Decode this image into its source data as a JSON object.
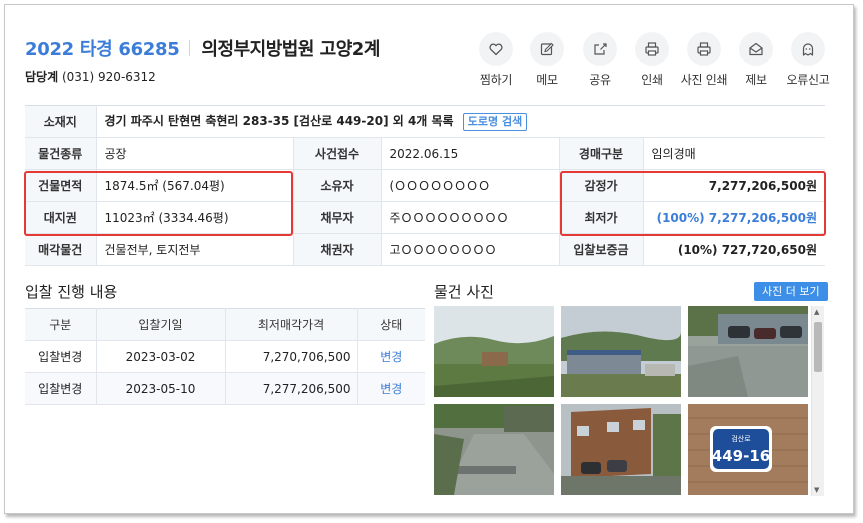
{
  "header": {
    "case_number": "2022 타경 66285",
    "court": "의정부지방법원 고양2계",
    "contact_label": "담당계",
    "contact_phone": "(031) 920-6312"
  },
  "actions": [
    {
      "label": "찜하기",
      "icon": "heart-icon"
    },
    {
      "label": "메모",
      "icon": "pencil-icon"
    },
    {
      "label": "공유",
      "icon": "share-icon"
    },
    {
      "label": "인쇄",
      "icon": "printer-icon"
    },
    {
      "label": "사진 인쇄",
      "icon": "printer-icon"
    },
    {
      "label": "제보",
      "icon": "envelope-icon"
    },
    {
      "label": "오류신고",
      "icon": "ghost-icon"
    }
  ],
  "info": {
    "location_label": "소재지",
    "location_value": "경기 파주시 탄현면 축현리 283-35 [검산로 449-20] 외 4개 목록",
    "road_search": "도로명 검색",
    "type_label": "물건종류",
    "type_value": "공장",
    "received_label": "사건접수",
    "received_value": "2022.06.15",
    "auction_type_label": "경매구분",
    "auction_type_value": "임의경매",
    "building_area_label": "건물면적",
    "building_area_value": "1874.5㎡ (567.04평)",
    "owner_label": "소유자",
    "owner_value": "(ＯＯＯＯＯＯＯＯ",
    "appraisal_label": "감정가",
    "appraisal_value": "7,277,206,500원",
    "land_right_label": "대지권",
    "land_right_value": "11023㎡ (3334.46평)",
    "debtor_label": "채무자",
    "debtor_value": "주ＯＯＯＯＯＯＯＯＯ",
    "min_price_label": "최저가",
    "min_price_value": "(100%) 7,277,206,500원",
    "sale_label": "매각물건",
    "sale_value": "건물전부, 토지전부",
    "creditor_label": "채권자",
    "creditor_value": "고ＯＯＯＯＯＯＯＯ",
    "deposit_label": "입찰보증금",
    "deposit_value": "(10%) 727,720,650원"
  },
  "bid_section": {
    "title": "입찰 진행 내용",
    "headers": [
      "구분",
      "입찰기일",
      "최저매각가격",
      "상태"
    ],
    "rows": [
      {
        "type": "입찰변경",
        "date": "2023-03-02",
        "price": "7,270,706,500",
        "status": "변경"
      },
      {
        "type": "입찰변경",
        "date": "2023-05-10",
        "price": "7,277,206,500",
        "status": "변경"
      }
    ]
  },
  "photo_section": {
    "title": "물건 사진",
    "more_button": "사진 더 보기",
    "sign_line1": "검산로",
    "sign_line2": "449-16",
    "colors": {
      "accent": "#3b7dd8",
      "highlight": "#e53935"
    }
  }
}
